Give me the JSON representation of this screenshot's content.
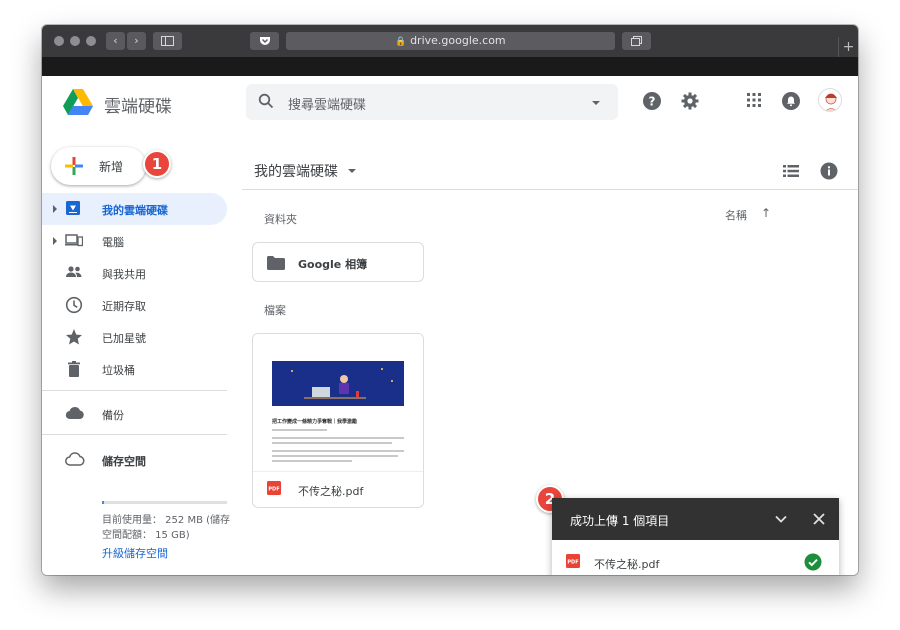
{
  "browser": {
    "address": "drive.google.com",
    "back_glyph": "‹",
    "forward_glyph": "›",
    "new_tab_glyph": "+"
  },
  "header": {
    "brand": "雲端硬碟",
    "search_placeholder": "搜尋雲端硬碟",
    "icons": [
      "search-icon",
      "help-icon",
      "settings-icon",
      "apps-icon",
      "notifications-icon",
      "avatar"
    ]
  },
  "sidebar": {
    "new_label": "新增",
    "items": [
      {
        "label": "我的雲端硬碟",
        "icon": "drive-icon",
        "active": true,
        "expandable": true
      },
      {
        "label": "電腦",
        "icon": "computer-icon",
        "active": false,
        "expandable": true
      },
      {
        "label": "與我共用",
        "icon": "shared-icon",
        "active": false
      },
      {
        "label": "近期存取",
        "icon": "clock-icon",
        "active": false
      },
      {
        "label": "已加星號",
        "icon": "star-icon",
        "active": false
      },
      {
        "label": "垃圾桶",
        "icon": "trash-icon",
        "active": false
      },
      {
        "label": "備份",
        "icon": "cloud-icon",
        "active": false
      },
      {
        "label": "儲存空間",
        "icon": "cloud-outline-icon",
        "active": false
      }
    ],
    "storage": {
      "used_line": "目前使用量： 252 MB (儲存",
      "quota_line": "空間配額： 15 GB)",
      "used_fraction": 0.016,
      "upgrade": "升級儲存空間"
    }
  },
  "main": {
    "breadcrumb": "我的雲端硬碟",
    "folders_label": "資料夾",
    "files_label": "檔案",
    "sort_label": "名稱",
    "sort_arrow": "↑",
    "folders": [
      {
        "name": "Google 相簿"
      }
    ],
    "files": [
      {
        "name": "不传之秘.pdf",
        "type": "PDF",
        "thumb_title": "把工作變成一條精力爭奪戰｜我學激勵"
      }
    ]
  },
  "upload_toast": {
    "title": "成功上傳 1 個項目",
    "items": [
      {
        "name": "不传之秘.pdf",
        "status": "done"
      }
    ]
  },
  "annotations": {
    "marker_1": "1",
    "marker_2": "2"
  },
  "colors": {
    "accent": "#1967d2",
    "active_bg": "#e8f0fe",
    "marker": "#e8453c",
    "success": "#1e8e3e",
    "pdf": "#ea4335"
  }
}
